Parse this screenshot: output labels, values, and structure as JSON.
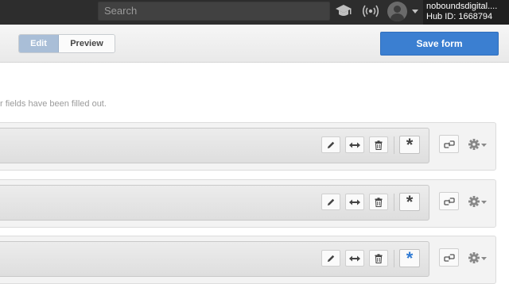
{
  "topbar": {
    "search_placeholder": "Search",
    "account_name": "noboundsdigital....",
    "hub_id": "Hub ID: 1668794",
    "icons": [
      "graduation-cap-icon",
      "broadcast-icon",
      "avatar-icon",
      "chevron-down-icon"
    ]
  },
  "toolbar": {
    "edit_label": "Edit",
    "preview_label": "Preview",
    "save_label": "Save form",
    "accent": "#3b7fd1"
  },
  "note": "r fields have been filled out.",
  "fields": [
    {
      "required_icon": "*",
      "required_active": false
    },
    {
      "required_icon": "*",
      "required_active": false
    },
    {
      "required_icon": "*",
      "required_active": true
    }
  ],
  "colors": {
    "required_active": "#2f7ad4"
  }
}
